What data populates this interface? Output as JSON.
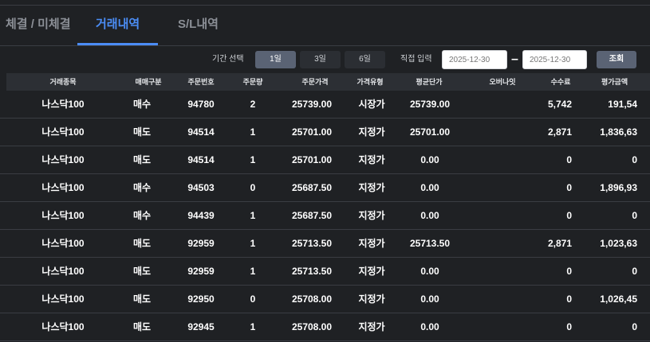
{
  "tabs": [
    {
      "label": "체결 / 미체결"
    },
    {
      "label": "거래내역"
    },
    {
      "label": "S/L내역"
    }
  ],
  "filter": {
    "period_label": "기간 선택",
    "period_buttons": [
      "1일",
      "3일",
      "6일"
    ],
    "direct_label": "직접 입력",
    "start_date": "2025-12-30",
    "end_date": "2025-12-30",
    "date_separator": "–",
    "search_label": "조회"
  },
  "table": {
    "headers": [
      "거래종목",
      "매매구분",
      "주문번호",
      "주문량",
      "주문가격",
      "가격유형",
      "평균단가",
      "오버나잇",
      "수수료",
      "평가금액"
    ],
    "rows": [
      [
        "나스닥100",
        "매수",
        "94780",
        "2",
        "25739.00",
        "시장가",
        "25739.00",
        "",
        "5,742",
        "191,54"
      ],
      [
        "나스닥100",
        "매도",
        "94514",
        "1",
        "25701.00",
        "지정가",
        "25701.00",
        "",
        "2,871",
        "1,836,63"
      ],
      [
        "나스닥100",
        "매도",
        "94514",
        "1",
        "25701.00",
        "지정가",
        "0.00",
        "",
        "0",
        "0"
      ],
      [
        "나스닥100",
        "매수",
        "94503",
        "0",
        "25687.50",
        "지정가",
        "0.00",
        "",
        "0",
        "1,896,93"
      ],
      [
        "나스닥100",
        "매수",
        "94439",
        "1",
        "25687.50",
        "지정가",
        "0.00",
        "",
        "0",
        "0"
      ],
      [
        "나스닥100",
        "매도",
        "92959",
        "1",
        "25713.50",
        "지정가",
        "25713.50",
        "",
        "2,871",
        "1,023,63"
      ],
      [
        "나스닥100",
        "매도",
        "92959",
        "1",
        "25713.50",
        "지정가",
        "0.00",
        "",
        "0",
        "0"
      ],
      [
        "나스닥100",
        "매도",
        "92950",
        "0",
        "25708.00",
        "지정가",
        "0.00",
        "",
        "0",
        "1,026,45"
      ],
      [
        "나스닥100",
        "매도",
        "92945",
        "1",
        "25708.00",
        "지정가",
        "0.00",
        "",
        "0",
        "0"
      ]
    ]
  },
  "colors": {
    "background": "#1f2124",
    "accent": "#4b8df5",
    "header_bg": "#2c2f34",
    "button_active": "#5a6374"
  }
}
